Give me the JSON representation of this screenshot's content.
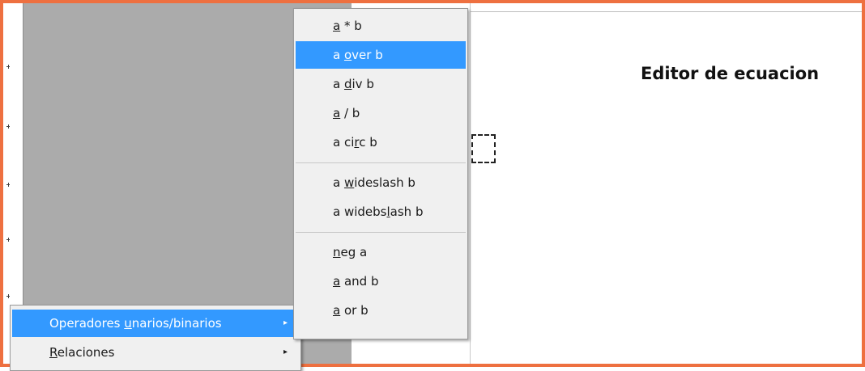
{
  "document": {
    "title": "Editor de ecuacion"
  },
  "parent_menu": {
    "items": [
      {
        "pre": "Operadores ",
        "acc": "u",
        "post": "narios/binarios",
        "has_submenu": true,
        "highlighted": true
      },
      {
        "pre": "",
        "acc": "R",
        "post": "elaciones",
        "has_submenu": true,
        "highlighted": false
      }
    ]
  },
  "submenu": {
    "groups": [
      [
        {
          "pre": "",
          "acc": "a",
          "post": " * b",
          "highlighted": false
        },
        {
          "pre": "a ",
          "acc": "o",
          "post": "ver b",
          "highlighted": true
        },
        {
          "pre": "a ",
          "acc": "d",
          "post": "iv b",
          "highlighted": false
        },
        {
          "pre": "",
          "acc": "a",
          "post": " / b",
          "highlighted": false
        },
        {
          "pre": "a ci",
          "acc": "r",
          "post": "c b",
          "highlighted": false
        }
      ],
      [
        {
          "pre": "a ",
          "acc": "w",
          "post": "ideslash b",
          "highlighted": false
        },
        {
          "pre": "a widebs",
          "acc": "l",
          "post": "ash b",
          "highlighted": false
        }
      ],
      [
        {
          "pre": "",
          "acc": "n",
          "post": "eg a",
          "highlighted": false
        },
        {
          "pre": "",
          "acc": "a",
          "post": " and b",
          "highlighted": false
        },
        {
          "pre": "",
          "acc": "a",
          "post": " or b",
          "highlighted": false
        }
      ]
    ]
  },
  "icons": {
    "submenu_arrow": "▸"
  },
  "colors": {
    "frame": "#ee7040",
    "highlight": "#3399ff",
    "gray_pane": "#ababab"
  }
}
